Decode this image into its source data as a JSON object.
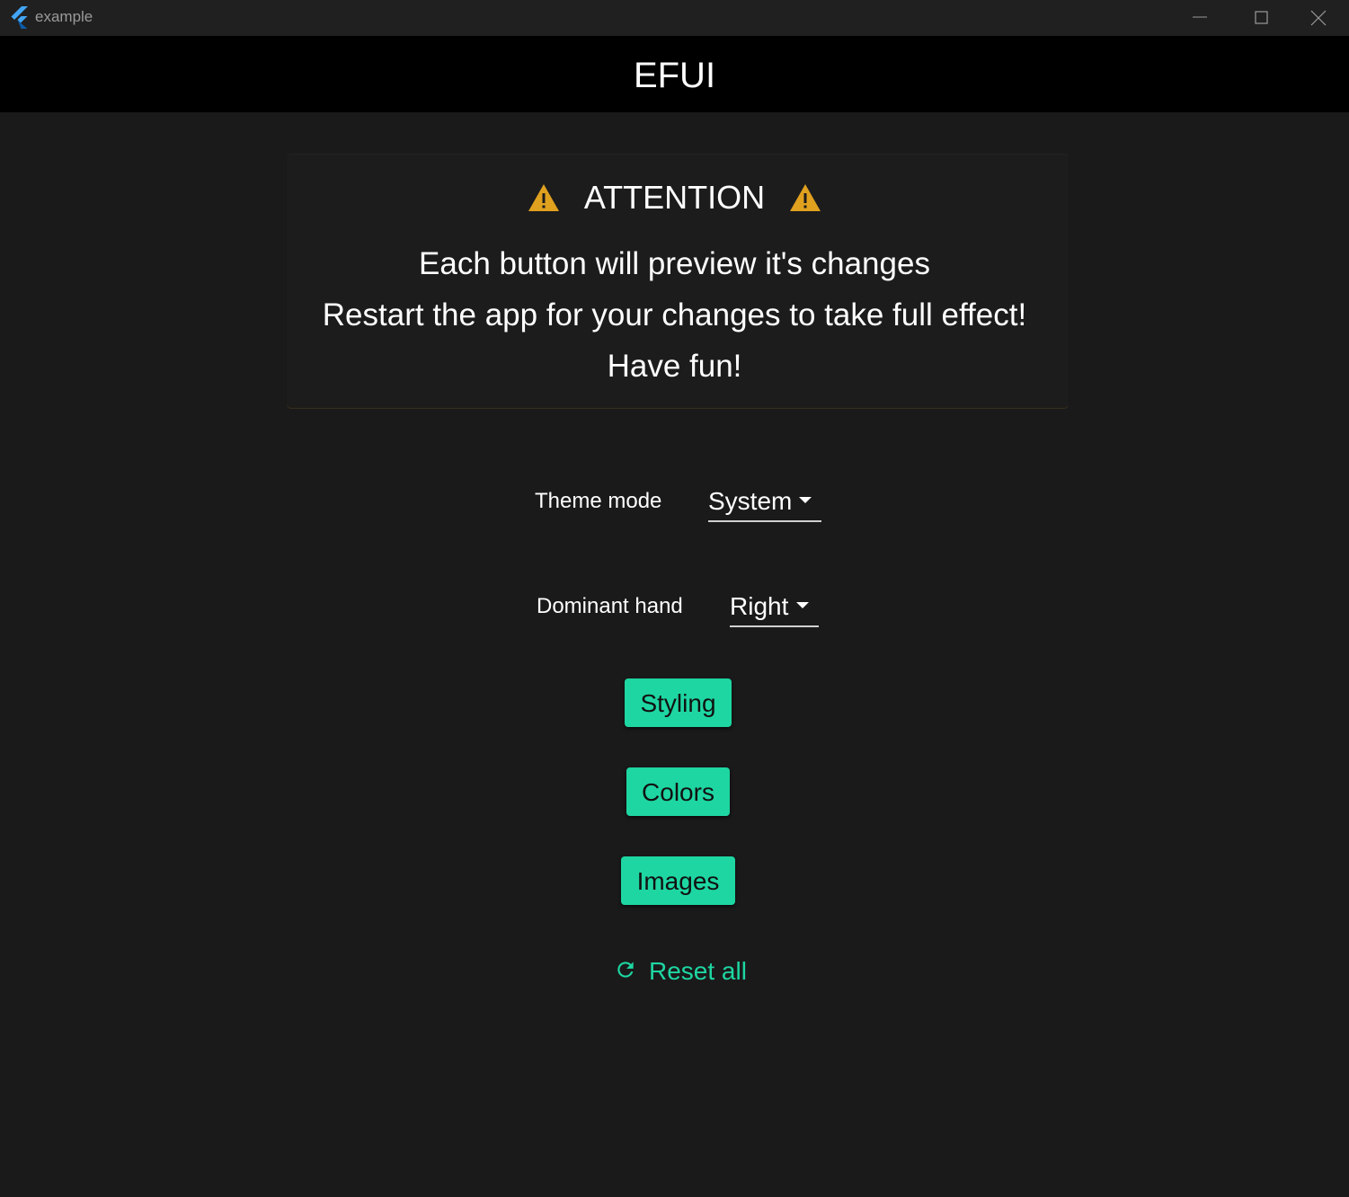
{
  "window": {
    "title": "example",
    "controls": [
      "minimize-icon",
      "maximize-icon",
      "close-icon"
    ]
  },
  "appbar": {
    "title": "EFUI"
  },
  "notice": {
    "heading": "ATTENTION",
    "icon": "warning-icon",
    "lines": [
      "Each button will preview it's changes",
      "Restart the app for your changes to take full effect!",
      "Have fun!"
    ]
  },
  "settings": {
    "theme_mode": {
      "label": "Theme mode",
      "value": "System"
    },
    "dominant_hand": {
      "label": "Dominant hand",
      "value": "Right"
    }
  },
  "buttons": {
    "styling": "Styling",
    "colors": "Colors",
    "images": "Images",
    "reset": "Reset all",
    "reset_icon": "refresh-icon"
  },
  "colors": {
    "accent": "#1ed6a2",
    "warning": "#e0a11f",
    "background": "#1a1a1a",
    "appbar": "#000000",
    "titlebar": "#202020"
  }
}
